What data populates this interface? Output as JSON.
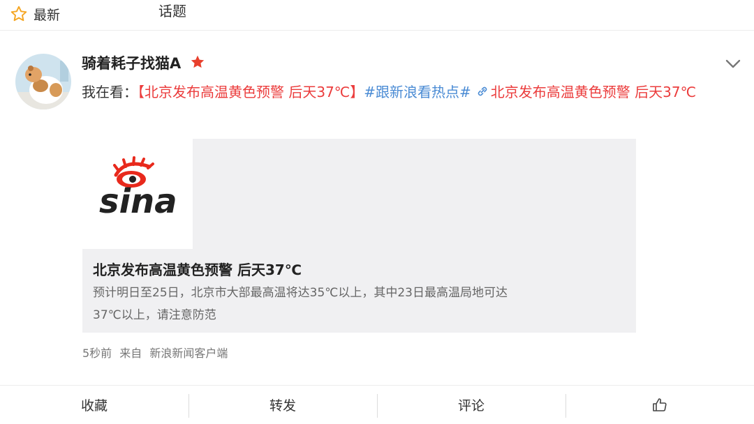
{
  "tabs": {
    "latest_label": "最新",
    "topic_label": "话题"
  },
  "post": {
    "username": "骑着耗子找猫A",
    "text_prefix": "我在看：",
    "headline_link": "【北京发布高温黄色预警 后天37℃】",
    "hashtag": "#跟新浪看热点#",
    "link_icon": "link-icon",
    "link_text": "北京发布高温黄色预警 后天37℃",
    "card": {
      "logo_text": "sina",
      "title": "北京发布高温黄色预警 后天37℃",
      "description": "预计明日至25日，北京市大部最高温将达35℃以上，其中23日最高温局地可达37℃以上，请注意防范"
    },
    "meta": {
      "time": "5秒前",
      "from_label": "来自",
      "source": "新浪新闻客户端"
    }
  },
  "actions": {
    "favorite": "收藏",
    "repost": "转发",
    "comment": "评论",
    "like_icon": "thumbs-up-icon"
  },
  "colors": {
    "link_red": "#eb3c3c",
    "hashtag_blue": "#4a8bd4",
    "star_orange": "#f5a623",
    "vip_red": "#e8402d",
    "card_bg": "#f0f0f2"
  }
}
